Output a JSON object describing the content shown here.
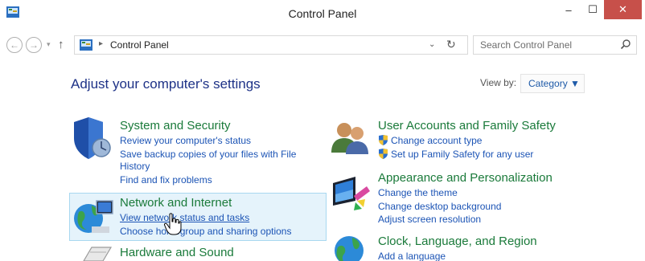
{
  "window": {
    "title": "Control Panel",
    "minimize": "–",
    "maximize": "☐",
    "close": "✕"
  },
  "nav": {
    "back": "←",
    "forward": "→",
    "recent": "▾",
    "up": "↑",
    "breadcrumb_sep": "▸",
    "address": "Control Panel",
    "address_dropdown": "⌄",
    "refresh": "↻",
    "search_placeholder": "Search Control Panel"
  },
  "content": {
    "heading": "Adjust your computer's settings",
    "view_by_label": "View by:",
    "view_by_value": "Category ▼"
  },
  "categories": {
    "system": {
      "title": "System and Security",
      "links": [
        "Review your computer's status",
        "Save backup copies of your files with File",
        "History",
        "Find and fix problems"
      ]
    },
    "network": {
      "title": "Network and Internet",
      "links": [
        "View network status and tasks",
        "Choose homegroup and sharing options"
      ]
    },
    "hardware": {
      "title": "Hardware and Sound"
    },
    "users": {
      "title": "User Accounts and Family Safety",
      "links": [
        "Change account type",
        "Set up Family Safety for any user"
      ]
    },
    "appearance": {
      "title": "Appearance and Personalization",
      "links": [
        "Change the theme",
        "Change desktop background",
        "Adjust screen resolution"
      ]
    },
    "clock": {
      "title": "Clock, Language, and Region",
      "links": [
        "Add a language"
      ]
    }
  },
  "icons": {
    "app": "control-panel-icon",
    "system": "shield-icon",
    "network": "globe-icon",
    "users": "users-icon",
    "appearance": "monitor-palette-icon",
    "clock": "globe-clock-icon",
    "hardware": "printer-icon"
  }
}
